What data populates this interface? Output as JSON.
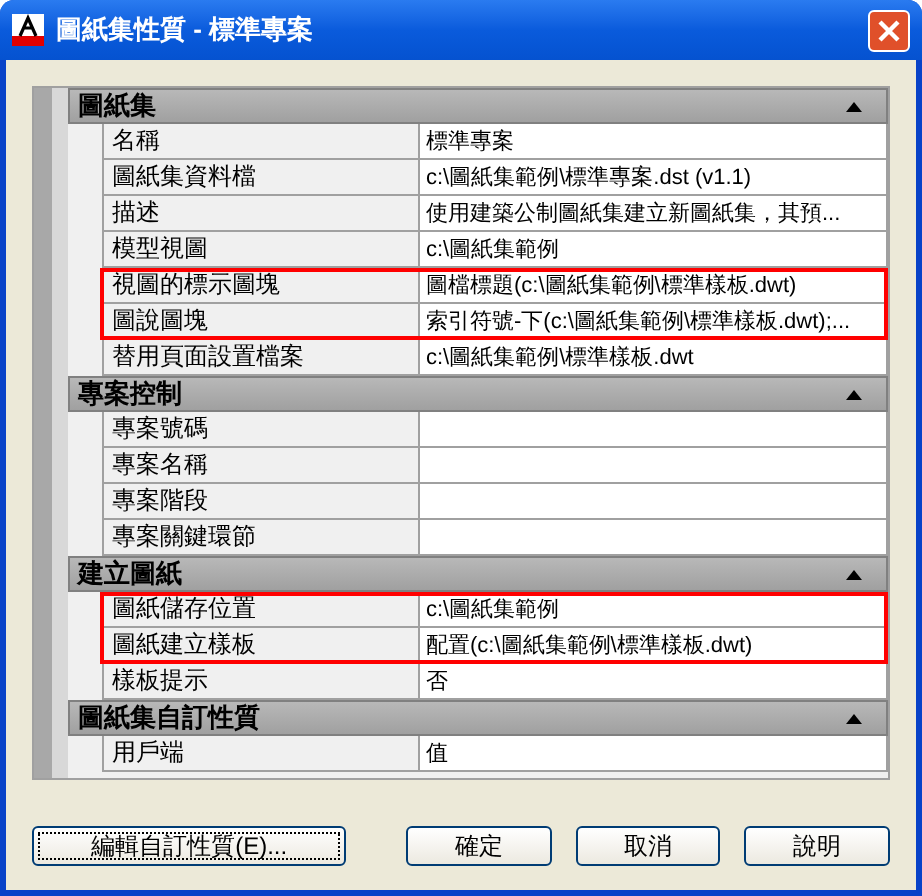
{
  "window": {
    "title": "圖紙集性質 - 標準專案"
  },
  "sections": [
    {
      "title": "圖紙集",
      "expanded": true,
      "rows": [
        {
          "label": "名稱",
          "value": "標準專案",
          "highlighted": false
        },
        {
          "label": "圖紙集資料檔",
          "value": "c:\\圖紙集範例\\標準專案.dst (v1.1)",
          "highlighted": false
        },
        {
          "label": "描述",
          "value": "使用建築公制圖紙集建立新圖紙集，其預...",
          "highlighted": false
        },
        {
          "label": "模型視圖",
          "value": "c:\\圖紙集範例",
          "highlighted": false
        },
        {
          "label": "視圖的標示圖塊",
          "value": "圖檔標題(c:\\圖紙集範例\\標準樣板.dwt)",
          "highlighted": true
        },
        {
          "label": "圖說圖塊",
          "value": "索引符號-下(c:\\圖紙集範例\\標準樣板.dwt);...",
          "highlighted": true
        },
        {
          "label": "替用頁面設置檔案",
          "value": "c:\\圖紙集範例\\標準樣板.dwt",
          "highlighted": false
        }
      ]
    },
    {
      "title": "專案控制",
      "expanded": true,
      "rows": [
        {
          "label": "專案號碼",
          "value": "",
          "highlighted": false
        },
        {
          "label": "專案名稱",
          "value": "",
          "highlighted": false
        },
        {
          "label": "專案階段",
          "value": "",
          "highlighted": false
        },
        {
          "label": "專案關鍵環節",
          "value": "",
          "highlighted": false
        }
      ]
    },
    {
      "title": "建立圖紙",
      "expanded": true,
      "rows": [
        {
          "label": "圖紙儲存位置",
          "value": "c:\\圖紙集範例",
          "highlighted": true
        },
        {
          "label": "圖紙建立樣板",
          "value": "配置(c:\\圖紙集範例\\標準樣板.dwt)",
          "highlighted": true
        },
        {
          "label": "樣板提示",
          "value": "否",
          "highlighted": false
        }
      ]
    },
    {
      "title": "圖紙集自訂性質",
      "expanded": true,
      "rows": [
        {
          "label": "用戶端",
          "value": "值",
          "highlighted": false
        }
      ]
    }
  ],
  "buttons": [
    {
      "label": "編輯自訂性質(E)...",
      "focused": true
    },
    {
      "label": "確定",
      "focused": false
    },
    {
      "label": "取消",
      "focused": false
    },
    {
      "label": "說明",
      "focused": false
    }
  ]
}
